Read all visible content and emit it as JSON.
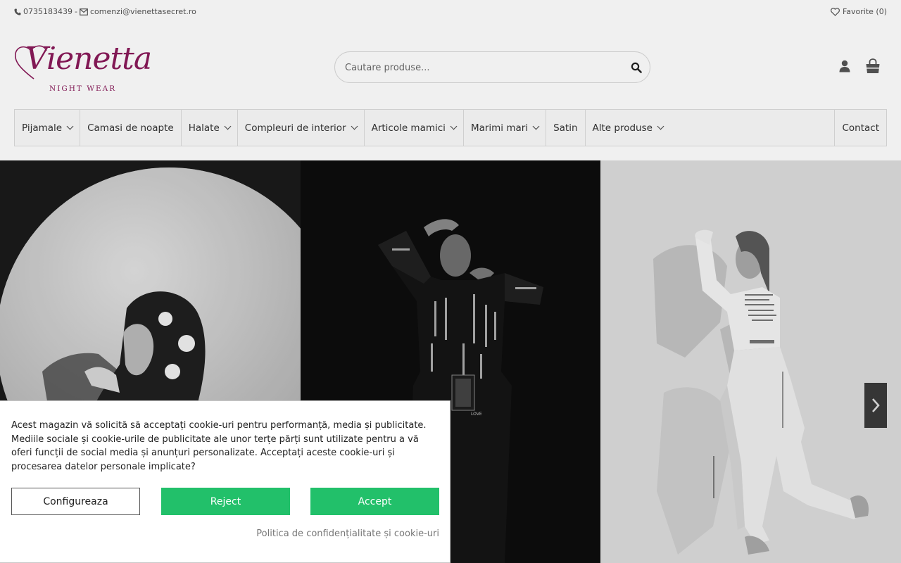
{
  "topbar": {
    "phone": "0735183439",
    "separator": "-",
    "email": "comenzi@vienettasecret.ro",
    "favorites": "Favorite (0)"
  },
  "logo": {
    "name": "Vienetta",
    "tagline": "NIGHT WEAR",
    "color": "#8a1a5a"
  },
  "search": {
    "placeholder": "Cautare produse..."
  },
  "icons": {
    "phone": "phone-icon",
    "email": "envelope-icon",
    "favorites": "heart-icon",
    "search": "search-icon",
    "account": "user-icon",
    "cart": "shopping-bag-icon",
    "chevron": "chevron-down-icon",
    "next": "chevron-right-icon"
  },
  "nav": {
    "items": [
      {
        "label": "Pijamale",
        "dropdown": true
      },
      {
        "label": "Camasi de noapte",
        "dropdown": false
      },
      {
        "label": "Halate",
        "dropdown": true
      },
      {
        "label": "Compleuri de interior",
        "dropdown": true
      },
      {
        "label": "Articole mamici",
        "dropdown": true
      },
      {
        "label": "Marimi mari",
        "dropdown": true
      },
      {
        "label": "Satin",
        "dropdown": false
      },
      {
        "label": "Alte produse",
        "dropdown": true
      }
    ],
    "contact": "Contact"
  },
  "banner": {
    "panel_labels": [
      "hooded model",
      "black print outfit",
      "white print outfit"
    ],
    "print_text": "LOVE"
  },
  "cookie": {
    "message": "Acest magazin vă solicită să acceptați cookie-uri pentru performanță, media și publicitate. Mediile sociale și cookie-urile de publicitate ale unor terțe părți sunt utilizate pentru a vă oferi funcții de social media și anunțuri personalizate. Acceptați aceste cookie-uri și procesarea datelor personale implicate?",
    "configure": "Configureaza",
    "reject": "Reject",
    "accept": "Accept",
    "policy": "Politica de confidențialitate și cookie-uri",
    "accent_color": "#22c06a"
  }
}
